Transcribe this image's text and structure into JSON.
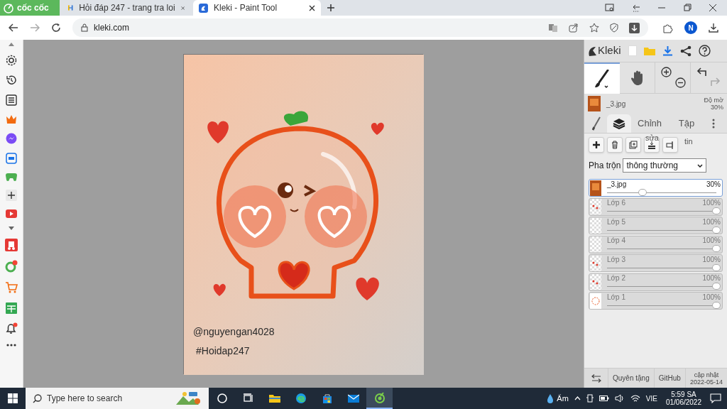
{
  "browser": {
    "brand": "cốc cốc",
    "tabs": [
      {
        "label": "Hỏi đáp 247 - trang tra loi",
        "selected": false
      },
      {
        "label": "Kleki - Paint Tool",
        "selected": true
      }
    ],
    "address": "kleki.com",
    "profile_initial": "N"
  },
  "canvas": {
    "texts": [
      "@nguyengan4028",
      "#Hoidap247"
    ]
  },
  "panel": {
    "logo": "Kleki",
    "current_layer": {
      "name": "_3.jpg",
      "opacity_label": "Độ mờ",
      "opacity": "30%"
    },
    "tabs": [
      {
        "kind": "brush",
        "selected": false
      },
      {
        "kind": "layers",
        "selected": true
      },
      {
        "kind": "text",
        "label": "Chỉnh",
        "overflow": "sửa",
        "selected": false
      },
      {
        "kind": "text",
        "label": "Tập",
        "overflow": "tin",
        "selected": false
      }
    ],
    "blend_label": "Pha trộn",
    "blend_value": "thông thường",
    "layers": [
      {
        "name": "_3.jpg",
        "opacity": "30%",
        "level": 0.3,
        "selected": true,
        "kind": "photo"
      },
      {
        "name": "Lớp 6",
        "opacity": "100%",
        "level": 1,
        "selected": false,
        "kind": "dots"
      },
      {
        "name": "Lớp 5",
        "opacity": "100%",
        "level": 1,
        "selected": false,
        "kind": "empty"
      },
      {
        "name": "Lớp 4",
        "opacity": "100%",
        "level": 1,
        "selected": false,
        "kind": "empty"
      },
      {
        "name": "Lớp 3",
        "opacity": "100%",
        "level": 1,
        "selected": false,
        "kind": "dots"
      },
      {
        "name": "Lớp 2",
        "opacity": "100%",
        "level": 1,
        "selected": false,
        "kind": "dots"
      },
      {
        "name": "Lớp 1",
        "opacity": "100%",
        "level": 1,
        "selected": false,
        "kind": "outline"
      }
    ],
    "footer": {
      "donate": "Quyên tặng",
      "github": "GitHub",
      "update_label": "cập nhật",
      "update_date": "2022-05-14"
    }
  },
  "taskbar": {
    "search_placeholder": "Type here to search",
    "apps": [
      {
        "kind": "cortana",
        "selected": false
      },
      {
        "kind": "taskview",
        "selected": false
      },
      {
        "kind": "explorer",
        "selected": false
      },
      {
        "kind": "edge",
        "selected": false
      },
      {
        "kind": "store",
        "selected": false
      },
      {
        "kind": "mail",
        "selected": false
      },
      {
        "kind": "coccoc",
        "selected": true
      }
    ],
    "weather": "Ẩm",
    "language": "VIE",
    "time": "5:59 SA",
    "date": "01/06/2022"
  }
}
